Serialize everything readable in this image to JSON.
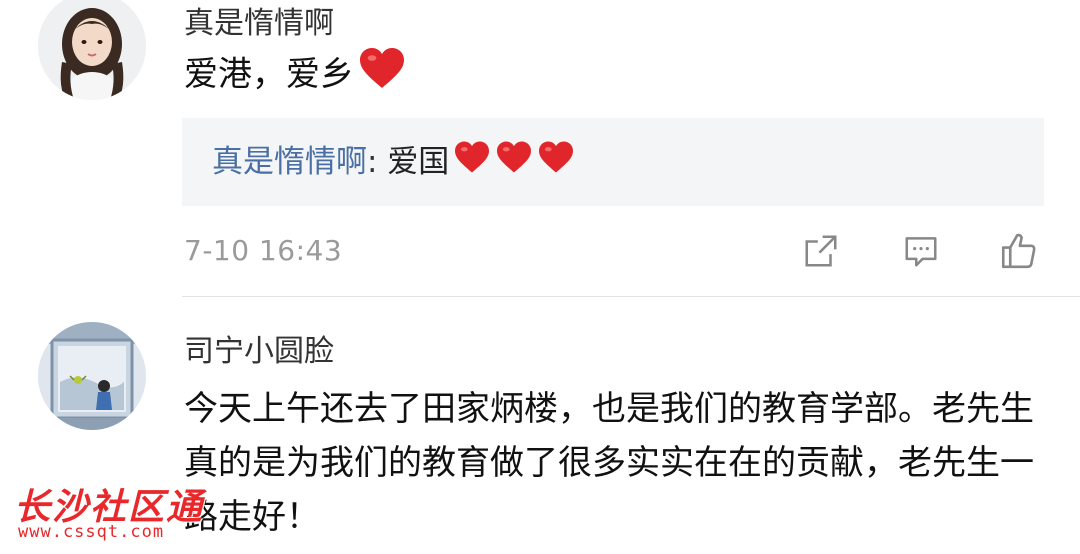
{
  "comments": [
    {
      "user": "真是惰情啊",
      "text": "爱港，爱乡",
      "reply": {
        "user": "真是惰情啊",
        "separator": ": ",
        "text": "爱国"
      },
      "time": "7-10 16:43"
    },
    {
      "user": "司宁小圆脸",
      "text": "今天上午还去了田家炳楼，也是我们的教育学部。老先生真的是为我们的教育做了很多实实在在的贡献，老先生一路走好！"
    }
  ],
  "actions": {
    "share_icon": "share-icon",
    "comment_icon": "comment-icon",
    "like_icon": "thumbs-up-icon"
  },
  "watermark": {
    "title": "长沙社区通",
    "url": "www.cssqt.com"
  },
  "colors": {
    "reply_user": "#4a6fa5",
    "reply_background": "#f4f5f7",
    "heart": "#e0262a",
    "timestamp": "#9a9a9a",
    "watermark": "#e8282b"
  }
}
